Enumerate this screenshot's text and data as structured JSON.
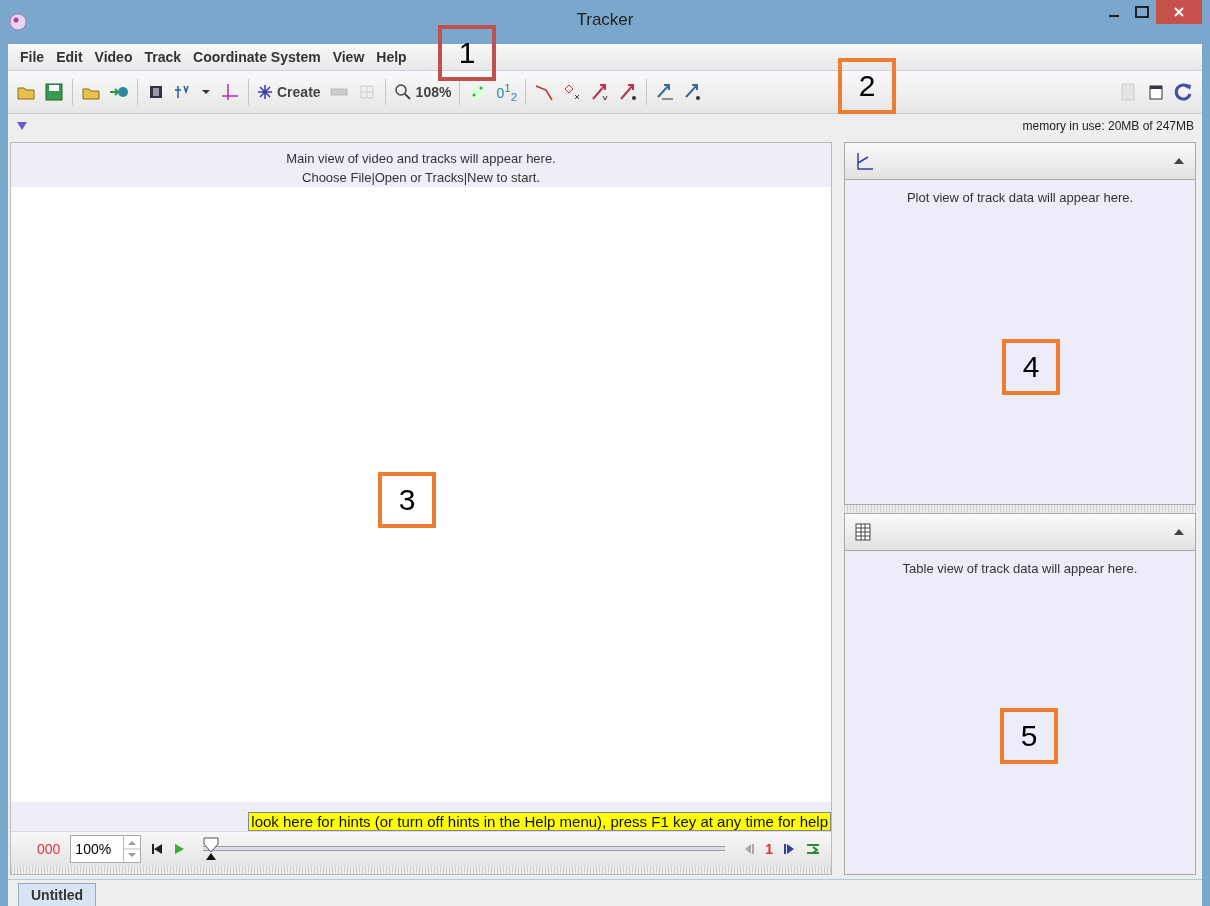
{
  "window": {
    "title": "Tracker"
  },
  "menu": [
    "File",
    "Edit",
    "Video",
    "Track",
    "Coordinate System",
    "View",
    "Help"
  ],
  "toolbar": {
    "create_label": "Create",
    "zoom": "108%",
    "number_format": "0$^{1}$$_{2}$"
  },
  "memory": "memory in use: 20MB of 247MB",
  "video_view": {
    "messages": [
      "Main view of video and tracks will appear here.",
      "Choose File|Open or Tracks|New to start."
    ],
    "hint": "look here for hints (or turn off hints in the Help menu), press F1 key at any time for help"
  },
  "player": {
    "frame": "000",
    "rate": "100%",
    "level": 0,
    "step": "1"
  },
  "plot_view": {
    "message": "Plot view of track data will appear here."
  },
  "table_view": {
    "message": "Table view of track data will appear here."
  },
  "tabs": [
    {
      "label": "Untitled",
      "selected": true
    }
  ],
  "callouts": [
    {
      "label": "1",
      "color": "#c0504d"
    },
    {
      "label": "2",
      "color": "#ed7d31"
    },
    {
      "label": "3",
      "color": "#ed7d31"
    },
    {
      "label": "4",
      "color": "#ed7d31"
    },
    {
      "label": "5",
      "color": "#ed7d31"
    }
  ]
}
